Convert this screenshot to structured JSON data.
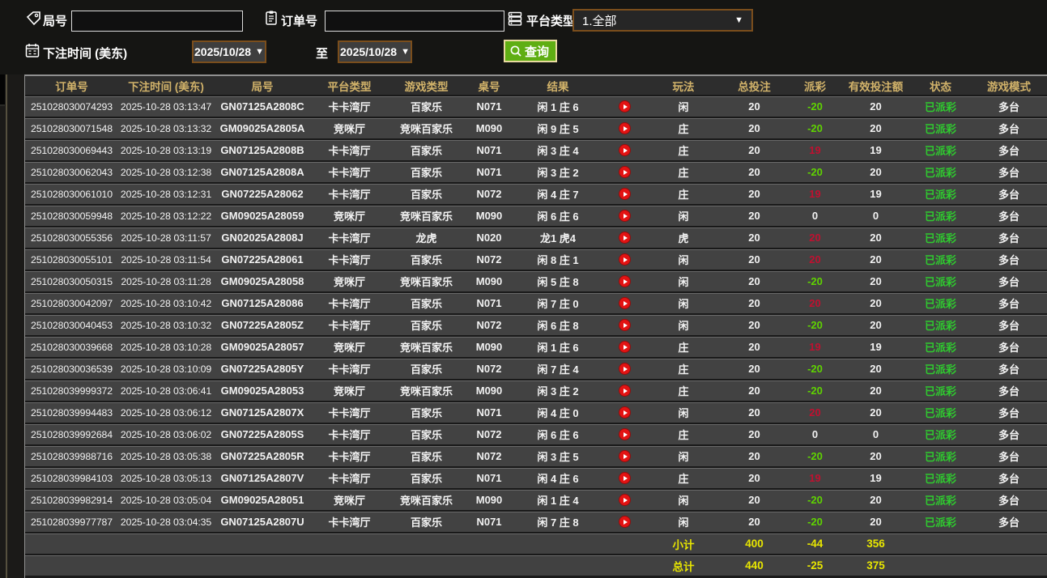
{
  "filters": {
    "game_no_label": "局号",
    "order_no_label": "订单号",
    "platform_label": "平台类型",
    "platform_value": "1.全部",
    "bet_time_label": "下注时间 (美东)",
    "date_from": "2025/10/28",
    "date_to": "2025/10/28",
    "to_label": "至",
    "query_label": "查询",
    "game_no_value": "",
    "order_no_value": ""
  },
  "icons": {
    "game_no": "tag-icon",
    "order_no": "clipboard-icon",
    "platform": "server-icon",
    "bet_time": "calendar-icon",
    "query": "search-icon",
    "replay": "play-icon",
    "dropdown": "caret-down-icon"
  },
  "colors": {
    "accent_gold": "#d2b36a",
    "button_green": "#5fae13",
    "payout_positive": "#c01030",
    "payout_negative": "#5fd400",
    "status_green": "#2fcb2f",
    "total_yellow": "#e8e600",
    "play_red": "#e31313"
  },
  "table": {
    "columns": [
      "订单号",
      "下注时间 (美东)",
      "局号",
      "平台类型",
      "游戏类型",
      "桌号",
      "结果",
      "",
      "玩法",
      "总投注",
      "派彩",
      "有效投注额",
      "状态",
      "游戏模式"
    ],
    "rows": [
      {
        "order_no": "251028030074293",
        "bet_time": "2025-10-28 03:13:47",
        "game_no": "GN07125A2808C",
        "platform": "卡卡湾厅",
        "game_type": "百家乐",
        "table_no": "N071",
        "result": "闲 1 庄 6",
        "bet_type": "闲",
        "total_bet": "20",
        "payout": "-20",
        "payout_class": "payneg",
        "valid_bet": "20",
        "status": "已派彩",
        "mode": "多台"
      },
      {
        "order_no": "251028030071548",
        "bet_time": "2025-10-28 03:13:32",
        "game_no": "GM09025A2805A",
        "platform": "竞咪厅",
        "game_type": "竞咪百家乐",
        "table_no": "M090",
        "result": "闲 9 庄 5",
        "bet_type": "庄",
        "total_bet": "20",
        "payout": "-20",
        "payout_class": "payneg",
        "valid_bet": "20",
        "status": "已派彩",
        "mode": "多台"
      },
      {
        "order_no": "251028030069443",
        "bet_time": "2025-10-28 03:13:19",
        "game_no": "GN07125A2808B",
        "platform": "卡卡湾厅",
        "game_type": "百家乐",
        "table_no": "N071",
        "result": "闲 3 庄 4",
        "bet_type": "庄",
        "total_bet": "20",
        "payout": "19",
        "payout_class": "paypos",
        "valid_bet": "19",
        "status": "已派彩",
        "mode": "多台"
      },
      {
        "order_no": "251028030062043",
        "bet_time": "2025-10-28 03:12:38",
        "game_no": "GN07125A2808A",
        "platform": "卡卡湾厅",
        "game_type": "百家乐",
        "table_no": "N071",
        "result": "闲 3 庄 2",
        "bet_type": "庄",
        "total_bet": "20",
        "payout": "-20",
        "payout_class": "payneg",
        "valid_bet": "20",
        "status": "已派彩",
        "mode": "多台"
      },
      {
        "order_no": "251028030061010",
        "bet_time": "2025-10-28 03:12:31",
        "game_no": "GN07225A28062",
        "platform": "卡卡湾厅",
        "game_type": "百家乐",
        "table_no": "N072",
        "result": "闲 4 庄 7",
        "bet_type": "庄",
        "total_bet": "20",
        "payout": "19",
        "payout_class": "paypos",
        "valid_bet": "19",
        "status": "已派彩",
        "mode": "多台"
      },
      {
        "order_no": "251028030059948",
        "bet_time": "2025-10-28 03:12:22",
        "game_no": "GM09025A28059",
        "platform": "竞咪厅",
        "game_type": "竞咪百家乐",
        "table_no": "M090",
        "result": "闲 6 庄 6",
        "bet_type": "闲",
        "total_bet": "20",
        "payout": "0",
        "payout_class": "payzero",
        "valid_bet": "0",
        "status": "已派彩",
        "mode": "多台"
      },
      {
        "order_no": "251028030055356",
        "bet_time": "2025-10-28 03:11:57",
        "game_no": "GN02025A2808J",
        "platform": "卡卡湾厅",
        "game_type": "龙虎",
        "table_no": "N020",
        "result": "龙1 虎4",
        "bet_type": "虎",
        "total_bet": "20",
        "payout": "20",
        "payout_class": "paypos",
        "valid_bet": "20",
        "status": "已派彩",
        "mode": "多台"
      },
      {
        "order_no": "251028030055101",
        "bet_time": "2025-10-28 03:11:54",
        "game_no": "GN07225A28061",
        "platform": "卡卡湾厅",
        "game_type": "百家乐",
        "table_no": "N072",
        "result": "闲 8 庄 1",
        "bet_type": "闲",
        "total_bet": "20",
        "payout": "20",
        "payout_class": "paypos",
        "valid_bet": "20",
        "status": "已派彩",
        "mode": "多台"
      },
      {
        "order_no": "251028030050315",
        "bet_time": "2025-10-28 03:11:28",
        "game_no": "GM09025A28058",
        "platform": "竞咪厅",
        "game_type": "竞咪百家乐",
        "table_no": "M090",
        "result": "闲 5 庄 8",
        "bet_type": "闲",
        "total_bet": "20",
        "payout": "-20",
        "payout_class": "payneg",
        "valid_bet": "20",
        "status": "已派彩",
        "mode": "多台"
      },
      {
        "order_no": "251028030042097",
        "bet_time": "2025-10-28 03:10:42",
        "game_no": "GN07125A28086",
        "platform": "卡卡湾厅",
        "game_type": "百家乐",
        "table_no": "N071",
        "result": "闲 7 庄 0",
        "bet_type": "闲",
        "total_bet": "20",
        "payout": "20",
        "payout_class": "paypos",
        "valid_bet": "20",
        "status": "已派彩",
        "mode": "多台"
      },
      {
        "order_no": "251028030040453",
        "bet_time": "2025-10-28 03:10:32",
        "game_no": "GN07225A2805Z",
        "platform": "卡卡湾厅",
        "game_type": "百家乐",
        "table_no": "N072",
        "result": "闲 6 庄 8",
        "bet_type": "闲",
        "total_bet": "20",
        "payout": "-20",
        "payout_class": "payneg",
        "valid_bet": "20",
        "status": "已派彩",
        "mode": "多台"
      },
      {
        "order_no": "251028030039668",
        "bet_time": "2025-10-28 03:10:28",
        "game_no": "GM09025A28057",
        "platform": "竞咪厅",
        "game_type": "竞咪百家乐",
        "table_no": "M090",
        "result": "闲 1 庄 6",
        "bet_type": "庄",
        "total_bet": "20",
        "payout": "19",
        "payout_class": "paypos",
        "valid_bet": "19",
        "status": "已派彩",
        "mode": "多台"
      },
      {
        "order_no": "251028030036539",
        "bet_time": "2025-10-28 03:10:09",
        "game_no": "GN07225A2805Y",
        "platform": "卡卡湾厅",
        "game_type": "百家乐",
        "table_no": "N072",
        "result": "闲 7 庄 4",
        "bet_type": "庄",
        "total_bet": "20",
        "payout": "-20",
        "payout_class": "payneg",
        "valid_bet": "20",
        "status": "已派彩",
        "mode": "多台"
      },
      {
        "order_no": "251028039999372",
        "bet_time": "2025-10-28 03:06:41",
        "game_no": "GM09025A28053",
        "platform": "竞咪厅",
        "game_type": "竞咪百家乐",
        "table_no": "M090",
        "result": "闲 3 庄 2",
        "bet_type": "庄",
        "total_bet": "20",
        "payout": "-20",
        "payout_class": "payneg",
        "valid_bet": "20",
        "status": "已派彩",
        "mode": "多台"
      },
      {
        "order_no": "251028039994483",
        "bet_time": "2025-10-28 03:06:12",
        "game_no": "GN07125A2807X",
        "platform": "卡卡湾厅",
        "game_type": "百家乐",
        "table_no": "N071",
        "result": "闲 4 庄 0",
        "bet_type": "闲",
        "total_bet": "20",
        "payout": "20",
        "payout_class": "paypos",
        "valid_bet": "20",
        "status": "已派彩",
        "mode": "多台"
      },
      {
        "order_no": "251028039992684",
        "bet_time": "2025-10-28 03:06:02",
        "game_no": "GN07225A2805S",
        "platform": "卡卡湾厅",
        "game_type": "百家乐",
        "table_no": "N072",
        "result": "闲 6 庄 6",
        "bet_type": "庄",
        "total_bet": "20",
        "payout": "0",
        "payout_class": "payzero",
        "valid_bet": "0",
        "status": "已派彩",
        "mode": "多台"
      },
      {
        "order_no": "251028039988716",
        "bet_time": "2025-10-28 03:05:38",
        "game_no": "GN07225A2805R",
        "platform": "卡卡湾厅",
        "game_type": "百家乐",
        "table_no": "N072",
        "result": "闲 3 庄 5",
        "bet_type": "闲",
        "total_bet": "20",
        "payout": "-20",
        "payout_class": "payneg",
        "valid_bet": "20",
        "status": "已派彩",
        "mode": "多台"
      },
      {
        "order_no": "251028039984103",
        "bet_time": "2025-10-28 03:05:13",
        "game_no": "GN07125A2807V",
        "platform": "卡卡湾厅",
        "game_type": "百家乐",
        "table_no": "N071",
        "result": "闲 4 庄 6",
        "bet_type": "庄",
        "total_bet": "20",
        "payout": "19",
        "payout_class": "paypos",
        "valid_bet": "19",
        "status": "已派彩",
        "mode": "多台"
      },
      {
        "order_no": "251028039982914",
        "bet_time": "2025-10-28 03:05:04",
        "game_no": "GM09025A28051",
        "platform": "竞咪厅",
        "game_type": "竞咪百家乐",
        "table_no": "M090",
        "result": "闲 1 庄 4",
        "bet_type": "闲",
        "total_bet": "20",
        "payout": "-20",
        "payout_class": "payneg",
        "valid_bet": "20",
        "status": "已派彩",
        "mode": "多台"
      },
      {
        "order_no": "251028039977787",
        "bet_time": "2025-10-28 03:04:35",
        "game_no": "GN07125A2807U",
        "platform": "卡卡湾厅",
        "game_type": "百家乐",
        "table_no": "N071",
        "result": "闲 7 庄 8",
        "bet_type": "闲",
        "total_bet": "20",
        "payout": "-20",
        "payout_class": "payneg",
        "valid_bet": "20",
        "status": "已派彩",
        "mode": "多台"
      }
    ],
    "subtotal": {
      "label": "小计",
      "total_bet": "400",
      "payout": "-44",
      "valid_bet": "356"
    },
    "grand_total": {
      "label": "总计",
      "total_bet": "440",
      "payout": "-25",
      "valid_bet": "375"
    }
  }
}
